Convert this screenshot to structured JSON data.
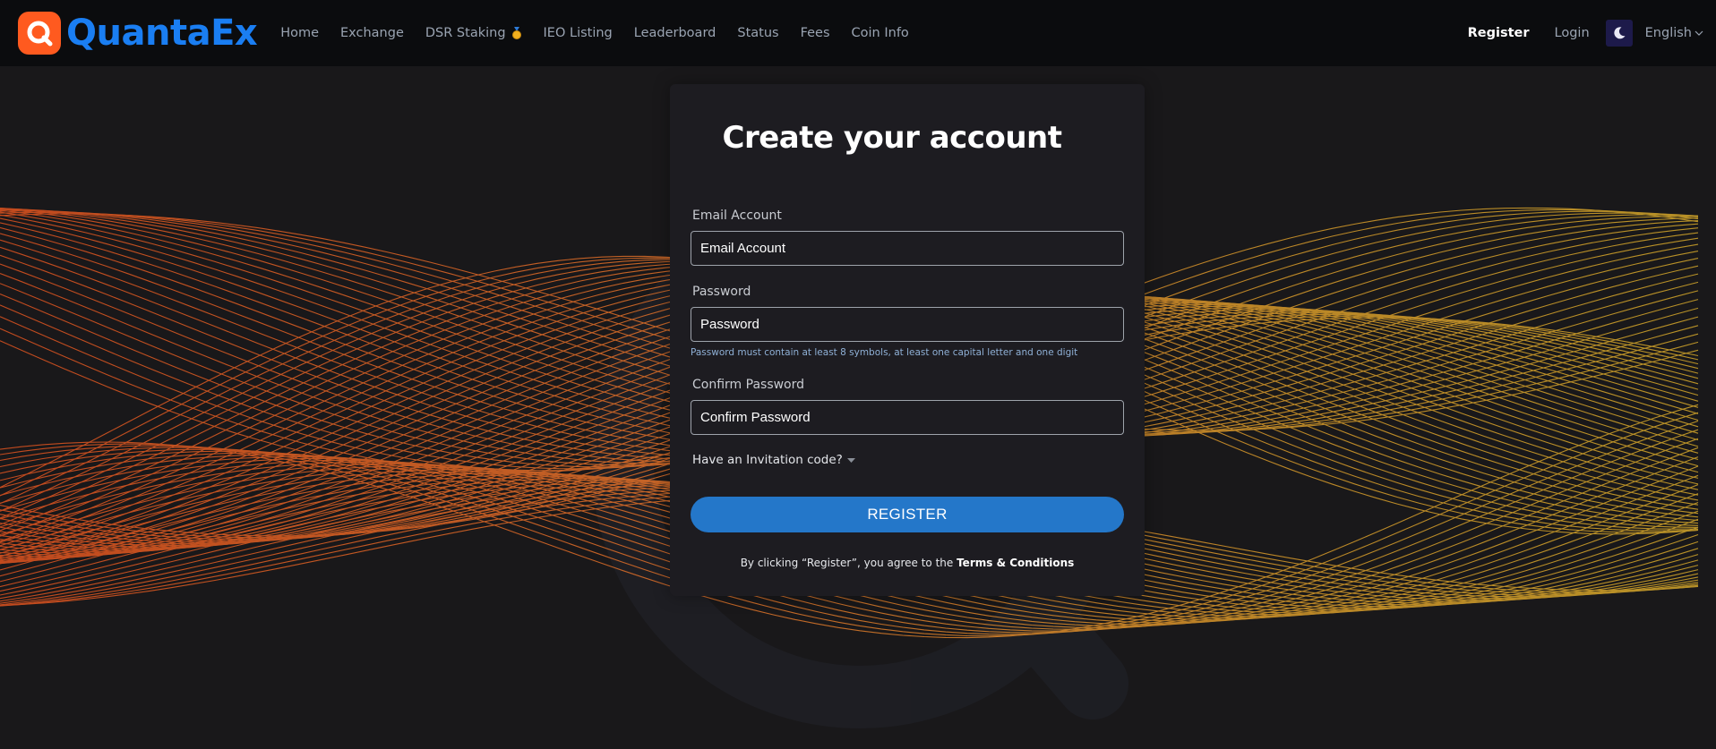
{
  "brand": {
    "name": "QuantaEx",
    "colors": {
      "logo_bg": "#ff5a1f",
      "logo_text": "#1a7ef2",
      "accent": "#2477c9"
    }
  },
  "nav": {
    "links": [
      {
        "label": "Home"
      },
      {
        "label": "Exchange"
      },
      {
        "label": "DSR Staking",
        "icon": "medal-icon"
      },
      {
        "label": "IEO Listing"
      },
      {
        "label": "Leaderboard"
      },
      {
        "label": "Status"
      },
      {
        "label": "Fees"
      },
      {
        "label": "Coin Info"
      }
    ],
    "register": "Register",
    "login": "Login",
    "theme_icon": "moon-icon",
    "language": "English"
  },
  "form": {
    "title": "Create your account",
    "email": {
      "label": "Email Account",
      "placeholder": "Email Account"
    },
    "password": {
      "label": "Password",
      "placeholder": "Password",
      "hint": "Password must contain at least 8 symbols, at least one capital letter and one digit"
    },
    "confirm": {
      "label": "Confirm Password",
      "placeholder": "Confirm Password"
    },
    "invitation": "Have an Invitation code?",
    "submit": "REGISTER",
    "terms_prefix": "By clicking “Register”, you agree to the",
    "terms_link": "Terms & Conditions"
  }
}
